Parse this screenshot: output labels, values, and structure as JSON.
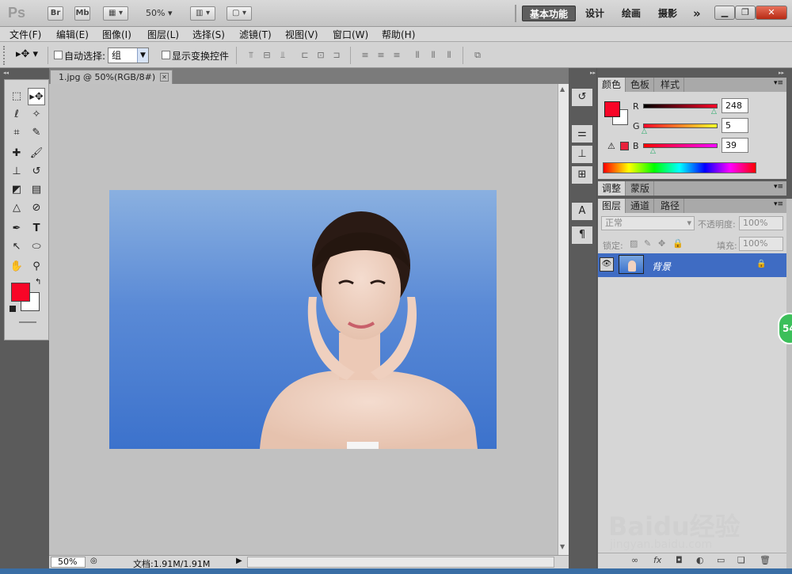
{
  "app": {
    "logo": "Ps",
    "bridge_label": "Br",
    "minibridge_label": "Mb",
    "zoom_label": "50%",
    "workspaces": [
      "基本功能",
      "设计",
      "绘画",
      "摄影"
    ],
    "more_label": "»"
  },
  "menu": [
    "文件(F)",
    "编辑(E)",
    "图像(I)",
    "图层(L)",
    "选择(S)",
    "滤镜(T)",
    "视图(V)",
    "窗口(W)",
    "帮助(H)"
  ],
  "options": {
    "auto_select_label": "自动选择:",
    "auto_select_value": "组",
    "show_transform_label": "显示变换控件"
  },
  "document": {
    "tab_title": "1.jpg @ 50%(RGB/8#)",
    "zoom": "50%",
    "doc_size": "文档:1.91M/1.91M"
  },
  "color_panel": {
    "tabs": [
      "颜色",
      "色板",
      "样式"
    ],
    "r_label": "R",
    "g_label": "G",
    "b_label": "B",
    "r_value": "248",
    "g_value": "5",
    "b_value": "39",
    "fg_color": "#f80527"
  },
  "adjust_panel": {
    "tabs": [
      "调整",
      "蒙版"
    ]
  },
  "layers_panel": {
    "tabs": [
      "图层",
      "通道",
      "路径"
    ],
    "blend_mode": "正常",
    "opacity_label": "不透明度:",
    "opacity_value": "100%",
    "lock_label": "锁定:",
    "fill_label": "填充:",
    "fill_value": "100%",
    "layers": [
      {
        "name": "背景",
        "locked": true,
        "visible": true
      }
    ]
  },
  "badge": "54",
  "watermark": {
    "brand": "Baidu经验",
    "url": "jingyan.baidu.com"
  }
}
